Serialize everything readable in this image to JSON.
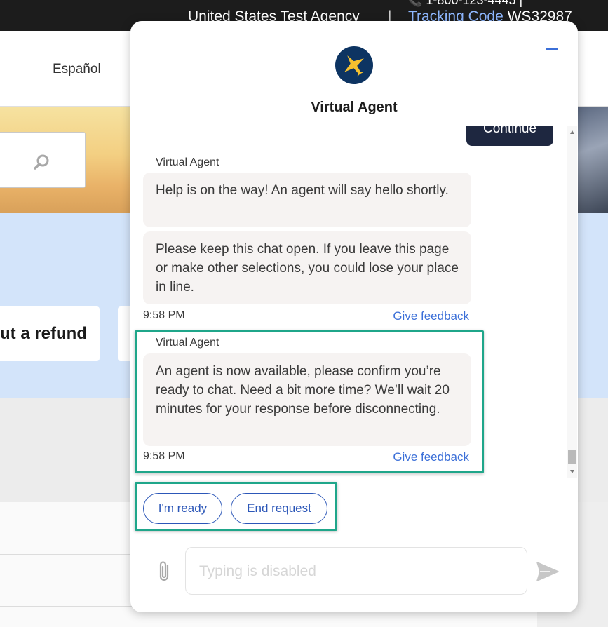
{
  "topbar": {
    "agency": "United States Test Agency",
    "separator": "|",
    "phone_partial": "📞 1-800-123-4445 |",
    "tracking_label": "Tracking Code ",
    "tracking_code": "WS32987"
  },
  "nav": {
    "language_link": "Español"
  },
  "page": {
    "refund_card_text": "ut a refund"
  },
  "chat": {
    "title": "Virtual Agent",
    "continue_label": "Continue",
    "messages": [
      {
        "sender": "Virtual Agent",
        "bubbles": [
          "Help is on the way! An agent will say hello shortly.",
          "Please keep this chat open. If you leave this page or make other selections, you could lose your place in line."
        ],
        "time": "9:58 PM",
        "feedback": "Give feedback"
      },
      {
        "sender": "Virtual Agent",
        "bubbles": [
          "An agent is now available, please confirm you’re ready to chat. Need a bit more time? We’ll wait 20 minutes for your response before disconnecting."
        ],
        "time": "9:58 PM",
        "feedback": "Give feedback"
      }
    ],
    "quick_replies": [
      "I'm ready",
      "End request"
    ],
    "input_placeholder": "Typing is disabled"
  },
  "colors": {
    "accent_blue": "#3b6fd8",
    "highlight_green": "#1fa68a",
    "continue_bg": "#1e2740",
    "bubble_bg": "#f6f3f2"
  }
}
